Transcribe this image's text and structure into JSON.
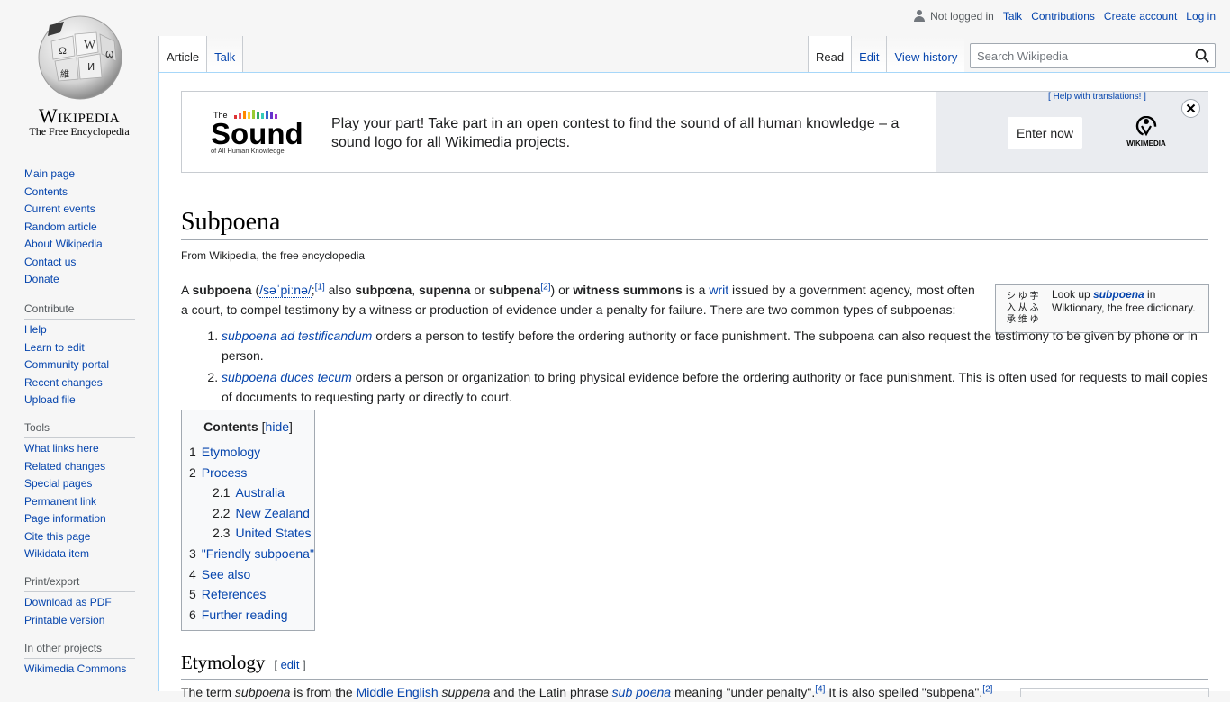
{
  "personal": {
    "not_logged_in": "Not logged in",
    "talk": "Talk",
    "contributions": "Contributions",
    "create_account": "Create account",
    "log_in": "Log in"
  },
  "logo": {
    "wordmark": "Wikipedia",
    "tagline": "The Free Encyclopedia"
  },
  "sidebar": {
    "navigation": [
      "Main page",
      "Contents",
      "Current events",
      "Random article",
      "About Wikipedia",
      "Contact us",
      "Donate"
    ],
    "contribute": {
      "heading": "Contribute",
      "items": [
        "Help",
        "Learn to edit",
        "Community portal",
        "Recent changes",
        "Upload file"
      ]
    },
    "tools": {
      "heading": "Tools",
      "items": [
        "What links here",
        "Related changes",
        "Special pages",
        "Permanent link",
        "Page information",
        "Cite this page",
        "Wikidata item"
      ]
    },
    "print": {
      "heading": "Print/export",
      "items": [
        "Download as PDF",
        "Printable version"
      ]
    },
    "projects": {
      "heading": "In other projects",
      "items": [
        "Wikimedia Commons"
      ]
    }
  },
  "tabs": {
    "article": "Article",
    "talk": "Talk",
    "read": "Read",
    "edit": "Edit",
    "view_history": "View history"
  },
  "search": {
    "placeholder": "Search Wikipedia"
  },
  "banner": {
    "logo_top": "The",
    "logo_main": "Sound",
    "logo_sub": "of All Human Knowledge",
    "message": "Play your part! Take part in an open contest to find the sound of all human knowledge – a sound logo for all Wikimedia projects.",
    "help": "[ Help with translations! ]",
    "enter_now": "Enter now",
    "wikimedia": "WIKIMEDIA",
    "close": "✕"
  },
  "article": {
    "title": "Subpoena",
    "from": "From Wikipedia, the free encyclopedia",
    "intro": {
      "a": "A ",
      "subpoena": "subpoena",
      "open": " (",
      "ipa": "/səˈpiːnə/",
      "semi": ";",
      "ref1": "[1]",
      "also": " also ",
      "subpoena2": "subpœna",
      "comma1": ", ",
      "supenna": "supenna",
      "or1": " or ",
      "subpena": "subpena",
      "ref2": "[2]",
      "close_or": ") or ",
      "witness": "witness summons",
      "is_a": " is a ",
      "writ": "writ",
      "rest": " issued by a government agency, most often a court, to compel testimony by a witness or production of evidence under a penalty for failure. There are two common types of subpoenas:"
    },
    "types": [
      {
        "term": "subpoena ad testificandum",
        "text": " orders a person to testify before the ordering authority or face punishment. The subpoena can also request the testimony to be given by phone or in person."
      },
      {
        "term": "subpoena duces tecum",
        "text": " orders a person or organization to bring physical evidence before the ordering authority or face punishment. This is often used for requests to mail copies of documents to requesting party or directly to court."
      }
    ],
    "wiktionary": {
      "glyphs": "シ ゆ 字\n入 从 ふ\n承 维 ゆ",
      "look_up": "Look up ",
      "term": "subpoena",
      "rest": " in Wiktionary, the free dictionary."
    },
    "toc": {
      "title": "Contents",
      "hide": "hide",
      "items": [
        {
          "num": "1",
          "label": "Etymology",
          "sub": false
        },
        {
          "num": "2",
          "label": "Process",
          "sub": false
        },
        {
          "num": "2.1",
          "label": "Australia",
          "sub": true
        },
        {
          "num": "2.2",
          "label": "New Zealand",
          "sub": true
        },
        {
          "num": "2.3",
          "label": "United States",
          "sub": true
        },
        {
          "num": "3",
          "label": "\"Friendly subpoena\"",
          "sub": false
        },
        {
          "num": "4",
          "label": "See also",
          "sub": false
        },
        {
          "num": "5",
          "label": "References",
          "sub": false
        },
        {
          "num": "6",
          "label": "Further reading",
          "sub": false
        }
      ]
    },
    "etymology": {
      "heading": "Etymology",
      "edit": "edit",
      "t1": "The term ",
      "t2": "subpoena",
      "t3": " is from the ",
      "t4": "Middle English",
      "t5": " ",
      "t6": "suppena",
      "t7": " and the Latin phrase ",
      "t8": "sub poena",
      "t9": " meaning \"under penalty\".",
      "ref4": "[4]",
      "t10": " It is also spelled \"subpena\".",
      "ref2": "[2]"
    }
  },
  "colors": {
    "link": "#0645ad",
    "page_bg": "#f6f6f6",
    "content_border": "#a7d7f9"
  }
}
